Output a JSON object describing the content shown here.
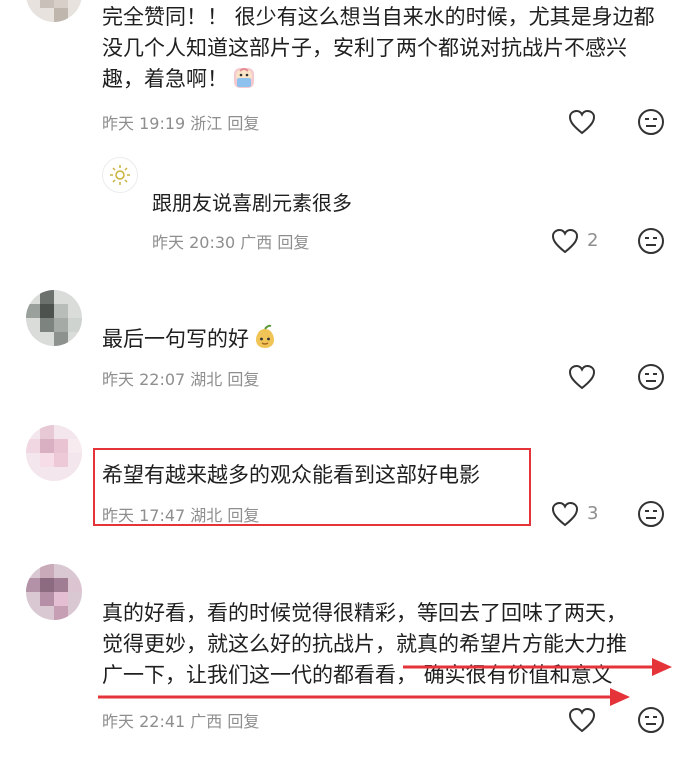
{
  "comments": [
    {
      "text_lines": [
        "完全赞同！！ 很少有这么想当自来水的时候，尤其是身边都",
        "没几个人知道这部片子，安利了两个都说对抗战片不感兴",
        "趣，着急啊！"
      ],
      "time": "昨天 19:19",
      "location": "浙江",
      "reply_label": "回复",
      "likes": ""
    },
    {
      "text_lines": [
        "跟朋友说喜剧元素很多"
      ],
      "time": "昨天 20:30",
      "location": "广西",
      "reply_label": "回复",
      "likes": "2"
    },
    {
      "text_lines": [
        "最后一句写的好"
      ],
      "time": "昨天 22:07",
      "location": "湖北",
      "reply_label": "回复",
      "likes": ""
    },
    {
      "text_lines": [
        "希望有越来越多的观众能看到这部好电影"
      ],
      "time": "昨天 17:47",
      "location": "湖北",
      "reply_label": "回复",
      "likes": "3"
    },
    {
      "text_lines": [
        "真的好看，看的时候觉得很精彩，等回去了回味了两天，",
        "觉得更妙，就这么好的抗战片，就真的希望片方能大力推",
        "广一下，让我们这一代的都看看， 确实很有价值和意义"
      ],
      "time": "昨天 22:41",
      "location": "广西",
      "reply_label": "回复",
      "likes": ""
    }
  ],
  "colors": {
    "annotation_red": "#e5333a",
    "meta_gray": "#8e8e8e"
  },
  "icons": {
    "like": "heart-outline-icon",
    "dislike": "neutral-face-icon",
    "reply_avatar": "sun-icon"
  }
}
